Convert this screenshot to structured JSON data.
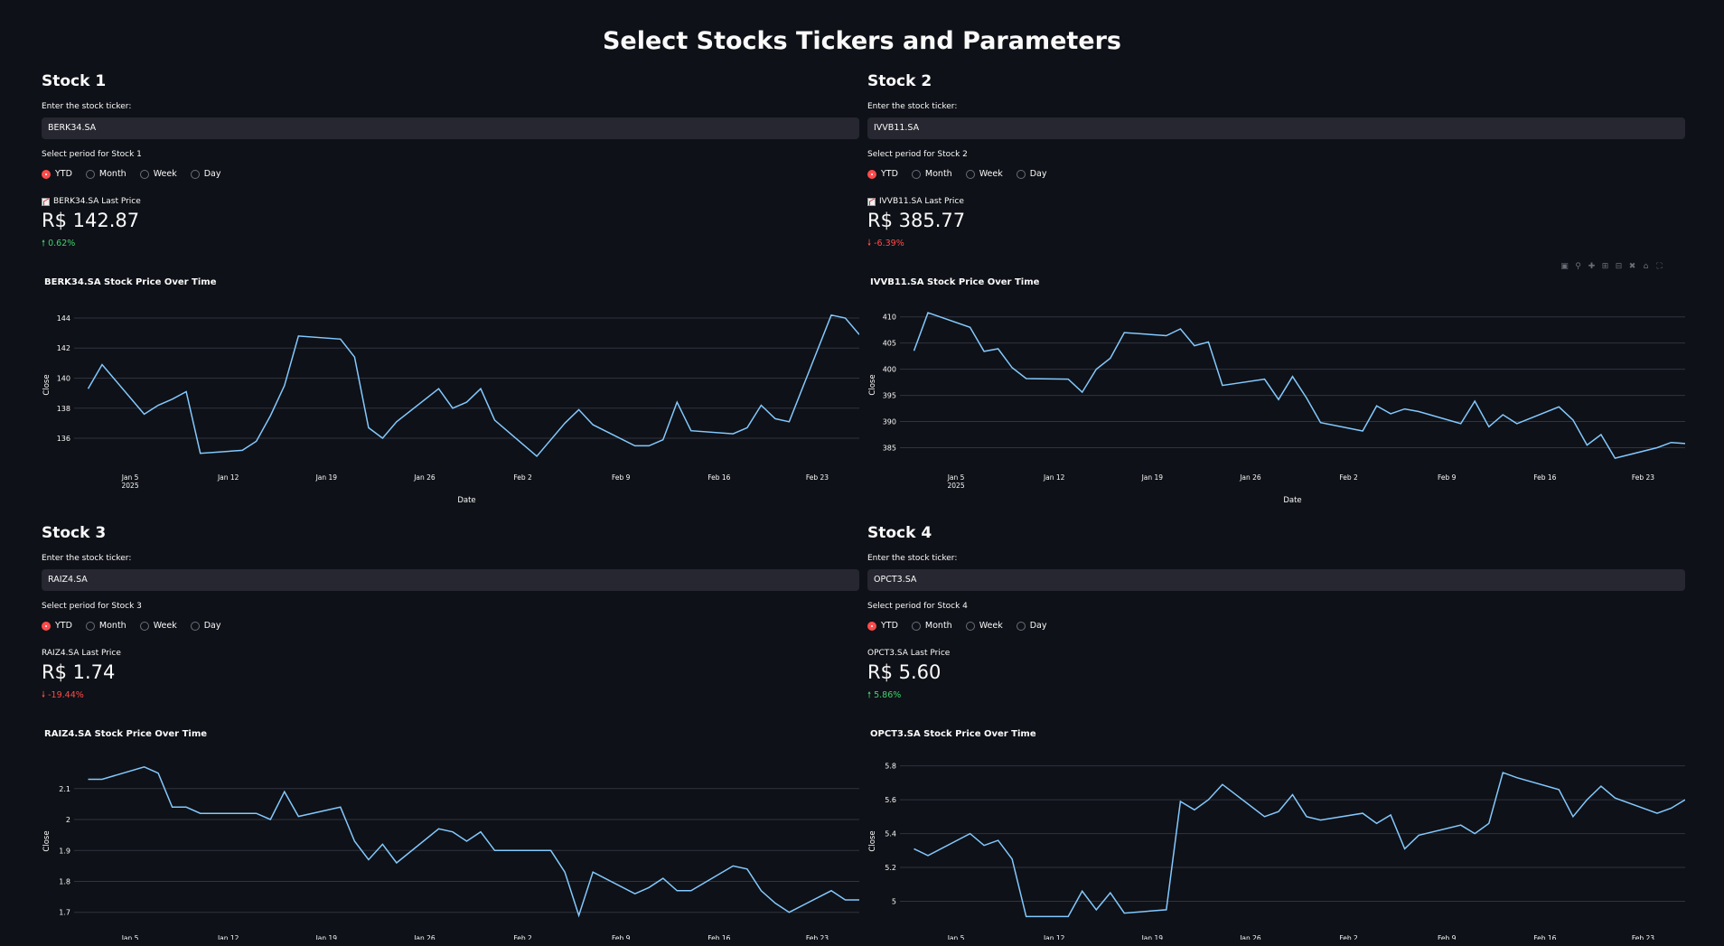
{
  "page": {
    "title": "Select Stocks Tickers and Parameters"
  },
  "common": {
    "ticker_label": "Enter the stock ticker:",
    "period_options": [
      "YTD",
      "Month",
      "Week",
      "Day"
    ],
    "x_tick_labels": [
      "Jan 5",
      "Jan 12",
      "Jan 19",
      "Jan 26",
      "Feb 2",
      "Feb 9",
      "Feb 16",
      "Feb 23"
    ],
    "x_year_label": "2025",
    "ylabel": "Close",
    "xlabel": "Date",
    "selected_period": "YTD",
    "colors": {
      "line": "#83c9ff",
      "up": "#3dd56d",
      "down": "#ff4b4b",
      "radio_selected": "#ff4b4b"
    }
  },
  "stocks": [
    {
      "heading": "Stock 1",
      "ticker": "BERK34.SA",
      "period_label": "Select period for Stock 1",
      "metric_label": "BERK34.SA Last Price",
      "metric_icon": "chart-increasing-emoji",
      "price": "R$ 142.87",
      "delta": "0.62%",
      "delta_direction": "up",
      "chart_title": "BERK34.SA Stock Price Over Time",
      "show_xlabel": true
    },
    {
      "heading": "Stock 2",
      "ticker": "IVVB11.SA",
      "period_label": "Select period for Stock 2",
      "metric_label": "IVVB11.SA Last Price",
      "metric_icon": "chart-increasing-emoji",
      "price": "R$ 385.77",
      "delta": "-6.39%",
      "delta_direction": "down",
      "chart_title": "IVVB11.SA Stock Price Over Time",
      "show_xlabel": true
    },
    {
      "heading": "Stock 3",
      "ticker": "RAIZ4.SA",
      "period_label": "Select period for Stock 3",
      "metric_label": "RAIZ4.SA Last Price",
      "metric_icon": "",
      "price": "R$ 1.74",
      "delta": "-19.44%",
      "delta_direction": "down",
      "chart_title": "RAIZ4.SA Stock Price Over Time",
      "show_xlabel": false
    },
    {
      "heading": "Stock 4",
      "ticker": "OPCT3.SA",
      "period_label": "Select period for Stock 4",
      "metric_label": "OPCT3.SA Last Price",
      "metric_icon": "",
      "price": "R$ 5.60",
      "delta": "5.86%",
      "delta_direction": "up",
      "chart_title": "OPCT3.SA Stock Price Over Time",
      "show_xlabel": false
    }
  ],
  "chart_data": [
    {
      "type": "line",
      "title": "BERK34.SA Stock Price Over Time",
      "xlabel": "Date",
      "ylabel": "Close",
      "x": [
        "2025-01-02",
        "2025-01-03",
        "2025-01-06",
        "2025-01-07",
        "2025-01-08",
        "2025-01-09",
        "2025-01-10",
        "2025-01-13",
        "2025-01-14",
        "2025-01-15",
        "2025-01-16",
        "2025-01-17",
        "2025-01-20",
        "2025-01-21",
        "2025-01-22",
        "2025-01-23",
        "2025-01-24",
        "2025-01-27",
        "2025-01-28",
        "2025-01-29",
        "2025-01-30",
        "2025-01-31",
        "2025-02-03",
        "2025-02-04",
        "2025-02-05",
        "2025-02-06",
        "2025-02-07",
        "2025-02-10",
        "2025-02-11",
        "2025-02-12",
        "2025-02-13",
        "2025-02-14",
        "2025-02-17",
        "2025-02-18",
        "2025-02-19",
        "2025-02-20",
        "2025-02-21",
        "2025-02-24",
        "2025-02-25",
        "2025-02-26"
      ],
      "y": [
        139.3,
        140.9,
        137.6,
        138.2,
        138.6,
        139.1,
        135.0,
        135.2,
        135.8,
        137.5,
        139.5,
        142.8,
        142.6,
        141.4,
        136.7,
        136.0,
        137.1,
        139.3,
        138.0,
        138.4,
        139.3,
        137.2,
        134.8,
        135.9,
        137.0,
        137.9,
        136.9,
        135.5,
        135.5,
        135.9,
        138.4,
        136.5,
        136.3,
        136.7,
        138.2,
        137.3,
        137.1,
        144.2,
        144.0,
        142.9
      ],
      "yticks": [
        136,
        138,
        140,
        142,
        144
      ],
      "ylim": [
        134.5,
        144.6
      ]
    },
    {
      "type": "line",
      "title": "IVVB11.SA Stock Price Over Time",
      "xlabel": "Date",
      "ylabel": "Close",
      "x": [
        "2025-01-02",
        "2025-01-03",
        "2025-01-06",
        "2025-01-07",
        "2025-01-08",
        "2025-01-09",
        "2025-01-10",
        "2025-01-13",
        "2025-01-14",
        "2025-01-15",
        "2025-01-16",
        "2025-01-17",
        "2025-01-20",
        "2025-01-21",
        "2025-01-22",
        "2025-01-23",
        "2025-01-24",
        "2025-01-27",
        "2025-01-28",
        "2025-01-29",
        "2025-01-30",
        "2025-01-31",
        "2025-02-03",
        "2025-02-04",
        "2025-02-05",
        "2025-02-06",
        "2025-02-07",
        "2025-02-10",
        "2025-02-11",
        "2025-02-12",
        "2025-02-13",
        "2025-02-14",
        "2025-02-17",
        "2025-02-18",
        "2025-02-19",
        "2025-02-20",
        "2025-02-21",
        "2025-02-24",
        "2025-02-25",
        "2025-02-26"
      ],
      "y": [
        403.5,
        410.8,
        408.0,
        403.4,
        403.9,
        400.3,
        398.2,
        398.1,
        395.6,
        400.0,
        402.1,
        407.0,
        406.4,
        407.7,
        404.5,
        405.2,
        396.9,
        398.1,
        394.2,
        398.6,
        394.5,
        389.8,
        388.2,
        393.0,
        391.5,
        392.4,
        391.9,
        389.6,
        393.9,
        389.0,
        391.3,
        389.6,
        392.8,
        390.3,
        385.5,
        387.5,
        383.0,
        385.0,
        386.0,
        385.8
      ],
      "yticks": [
        385,
        390,
        395,
        400,
        405,
        410
      ],
      "ylim": [
        382.5,
        411.5
      ]
    },
    {
      "type": "line",
      "title": "RAIZ4.SA Stock Price Over Time",
      "xlabel": "",
      "ylabel": "Close",
      "x": [
        "2025-01-02",
        "2025-01-03",
        "2025-01-06",
        "2025-01-07",
        "2025-01-08",
        "2025-01-09",
        "2025-01-10",
        "2025-01-13",
        "2025-01-14",
        "2025-01-15",
        "2025-01-16",
        "2025-01-17",
        "2025-01-20",
        "2025-01-21",
        "2025-01-22",
        "2025-01-23",
        "2025-01-24",
        "2025-01-27",
        "2025-01-28",
        "2025-01-29",
        "2025-01-30",
        "2025-01-31",
        "2025-02-03",
        "2025-02-04",
        "2025-02-05",
        "2025-02-06",
        "2025-02-07",
        "2025-02-10",
        "2025-02-11",
        "2025-02-12",
        "2025-02-13",
        "2025-02-14",
        "2025-02-17",
        "2025-02-18",
        "2025-02-19",
        "2025-02-20",
        "2025-02-21",
        "2025-02-24",
        "2025-02-25",
        "2025-02-26"
      ],
      "y": [
        2.13,
        2.13,
        2.17,
        2.15,
        2.04,
        2.04,
        2.02,
        2.02,
        2.02,
        2.0,
        2.09,
        2.01,
        2.04,
        1.93,
        1.87,
        1.92,
        1.86,
        1.97,
        1.96,
        1.93,
        1.96,
        1.9,
        1.9,
        1.9,
        1.83,
        1.69,
        1.83,
        1.76,
        1.78,
        1.81,
        1.77,
        1.77,
        1.85,
        1.84,
        1.77,
        1.73,
        1.7,
        1.77,
        1.74,
        1.74
      ],
      "yticks": [
        1.7,
        1.8,
        1.9,
        2,
        2.1
      ],
      "ylim": [
        1.67,
        2.19
      ]
    },
    {
      "type": "line",
      "title": "OPCT3.SA Stock Price Over Time",
      "xlabel": "",
      "ylabel": "Close",
      "x": [
        "2025-01-02",
        "2025-01-03",
        "2025-01-06",
        "2025-01-07",
        "2025-01-08",
        "2025-01-09",
        "2025-01-10",
        "2025-01-13",
        "2025-01-14",
        "2025-01-15",
        "2025-01-16",
        "2025-01-17",
        "2025-01-20",
        "2025-01-21",
        "2025-01-22",
        "2025-01-23",
        "2025-01-24",
        "2025-01-27",
        "2025-01-28",
        "2025-01-29",
        "2025-01-30",
        "2025-01-31",
        "2025-02-03",
        "2025-02-04",
        "2025-02-05",
        "2025-02-06",
        "2025-02-07",
        "2025-02-10",
        "2025-02-11",
        "2025-02-12",
        "2025-02-13",
        "2025-02-14",
        "2025-02-17",
        "2025-02-18",
        "2025-02-19",
        "2025-02-20",
        "2025-02-21",
        "2025-02-24",
        "2025-02-25",
        "2025-02-26"
      ],
      "y": [
        5.31,
        5.27,
        5.4,
        5.33,
        5.36,
        5.25,
        4.91,
        4.91,
        5.06,
        4.95,
        5.05,
        4.93,
        4.95,
        5.59,
        5.54,
        5.6,
        5.69,
        5.5,
        5.53,
        5.63,
        5.5,
        5.48,
        5.52,
        5.46,
        5.51,
        5.31,
        5.39,
        5.45,
        5.4,
        5.46,
        5.76,
        5.73,
        5.66,
        5.5,
        5.6,
        5.68,
        5.61,
        5.52,
        5.55,
        5.6
      ],
      "yticks": [
        5,
        5.2,
        5.4,
        5.6,
        5.8
      ],
      "ylim": [
        4.88,
        5.83
      ]
    }
  ]
}
